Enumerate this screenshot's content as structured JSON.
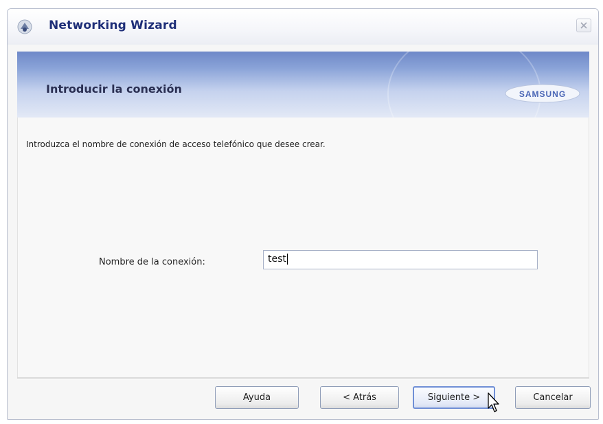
{
  "window": {
    "title": "Networking Wizard",
    "close_label": "×"
  },
  "banner": {
    "heading": "Introducir la conexión",
    "brand": "SAMSUNG"
  },
  "content": {
    "instruction": "Introduzca el nombre de conexión de acceso telefónico que desee crear.",
    "connection_name_label": "Nombre de la conexión:",
    "connection_name_value": "test"
  },
  "buttons": {
    "help": "Ayuda",
    "back": "< Atrás",
    "next": "Siguiente >",
    "cancel": "Cancelar"
  },
  "colors": {
    "title_text": "#1e2e78",
    "banner_top": "#6e88c8",
    "banner_bottom": "#e3e9f6",
    "focused_button_border": "#6f8fd6"
  },
  "icons": {
    "window_icon": "network-wizard-icon",
    "close": "close-icon",
    "cursor": "mouse-pointer-icon"
  }
}
